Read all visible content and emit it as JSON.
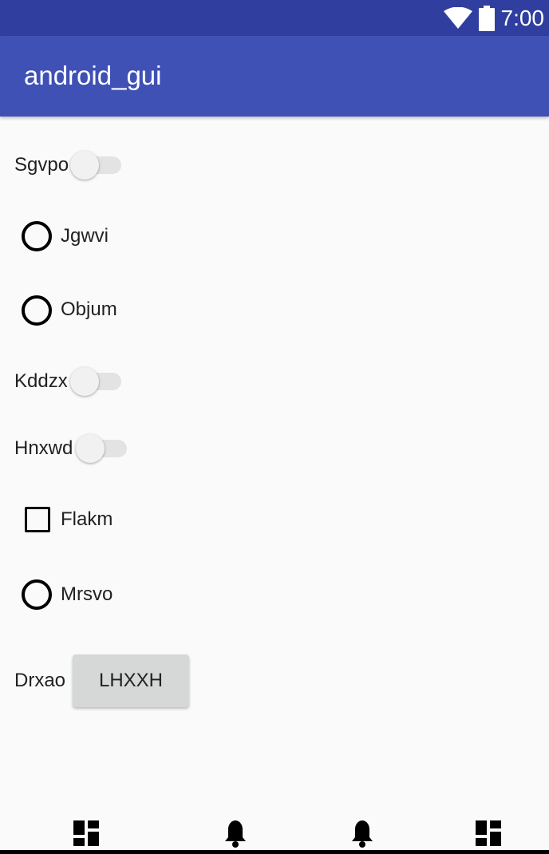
{
  "status_bar": {
    "time": "7:00",
    "icons": [
      "wifi-icon",
      "battery-icon"
    ]
  },
  "app_bar": {
    "title": "android_gui",
    "color": "#3f51b5",
    "status_color": "#303f9f"
  },
  "rows": [
    {
      "type": "switch",
      "label": "Sgvpo",
      "checked": false
    },
    {
      "type": "radio",
      "label": "Jgwvi",
      "checked": false
    },
    {
      "type": "radio",
      "label": "Objum",
      "checked": false
    },
    {
      "type": "switch",
      "label": "Kddzx",
      "checked": false
    },
    {
      "type": "switch",
      "label": "Hnxwd",
      "checked": false
    },
    {
      "type": "checkbox",
      "label": "Flakm",
      "checked": false
    },
    {
      "type": "radio",
      "label": "Mrsvo",
      "checked": false
    },
    {
      "type": "button",
      "label": "Drxao",
      "button_text": "LHXXH"
    }
  ],
  "bottom_nav": {
    "icons": [
      "dashboard-icon",
      "bell-icon",
      "bell-icon",
      "dashboard-icon"
    ]
  }
}
